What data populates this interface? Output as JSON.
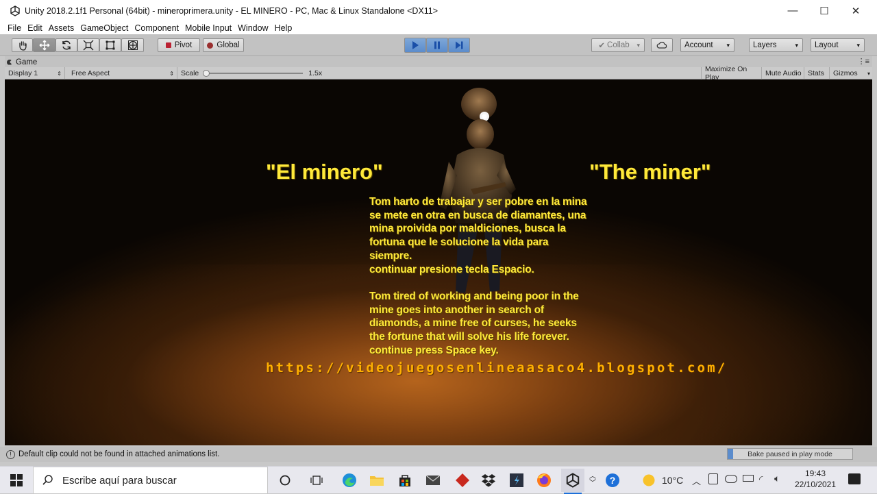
{
  "window": {
    "title": "Unity 2018.2.1f1 Personal (64bit) - mineroprimera.unity - EL MINERO - PC, Mac & Linux Standalone <DX11>",
    "minimize_glyph": "—",
    "maximize_glyph": "☐",
    "close_glyph": "✕"
  },
  "menu": [
    "File",
    "Edit",
    "Assets",
    "GameObject",
    "Component",
    "Mobile Input",
    "Window",
    "Help"
  ],
  "toolbar": {
    "tools": [
      "hand-tool-icon",
      "move-tool-icon",
      "rotate-tool-icon",
      "scale-tool-icon",
      "rect-tool-icon",
      "transform-tool-icon"
    ],
    "pivot_label": "Pivot",
    "global_label": "Global",
    "collab_label": "Collab",
    "account_label": "Account",
    "layers_label": "Layers",
    "layout_label": "Layout",
    "play_state": "playing"
  },
  "game_panel": {
    "tab_label": "Game",
    "display_label": "Display 1",
    "aspect_label": "Free Aspect",
    "scale_label": "Scale",
    "scale_value": "1.5x",
    "maximize_label": "Maximize On Play",
    "mute_label": "Mute Audio",
    "stats_label": "Stats",
    "gizmos_label": "Gizmos"
  },
  "game": {
    "title_es": "\"El minero\"",
    "title_en": "\"The miner\"",
    "story": "Tom harto de trabajar y ser pobre en la mina\nse mete en otra en busca de diamantes, una\nmina proivida por maldiciones, busca la\nfortuna que le solucione la vida para\nsiempre.\ncontinuar presione tecla Espacio.\n\nTom tired of working and being poor in the\nmine goes into another in search of\ndiamonds, a mine free of curses, he seeks\nthe fortune that will solve his life forever.\ncontinue press Space key.",
    "url": "https://videojuegosenlineaasaco4.blogspot.com/"
  },
  "status": {
    "message": "Default clip could not be found in attached animations list.",
    "bake_label": "Bake paused in play mode"
  },
  "taskbar": {
    "search_placeholder": "Escribe aquí para buscar",
    "weather": "10°C",
    "time": "19:43",
    "date": "22/10/2021",
    "accent": "#ffb000"
  }
}
